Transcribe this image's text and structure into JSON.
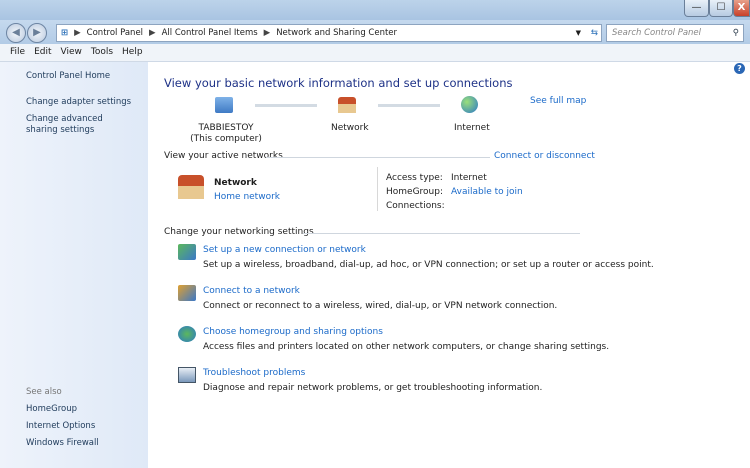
{
  "window": {
    "minimize": "—",
    "maximize": "☐",
    "close": "X"
  },
  "address": {
    "crumbs": [
      "Control Panel",
      "All Control Panel Items",
      "Network and Sharing Center"
    ],
    "search_placeholder": "Search Control Panel"
  },
  "menu": [
    "File",
    "Edit",
    "View",
    "Tools",
    "Help"
  ],
  "sidebar": {
    "home": "Control Panel Home",
    "items": [
      "Change adapter settings",
      "Change advanced sharing settings"
    ],
    "see_also_label": "See also",
    "see_also": [
      "HomeGroup",
      "Internet Options",
      "Windows Firewall"
    ]
  },
  "main": {
    "title": "View your basic network information and set up connections",
    "see_full_map": "See full map",
    "map": {
      "computer": "TABBIESTOY",
      "computer_sub": "(This computer)",
      "network": "Network",
      "internet": "Internet"
    },
    "active_label": "View your active networks",
    "connect_disconnect": "Connect or disconnect",
    "network_name": "Network",
    "network_type": "Home network",
    "access_type_label": "Access type:",
    "access_type": "Internet",
    "homegroup_label": "HomeGroup:",
    "homegroup": "Available to join",
    "connections_label": "Connections:",
    "change_label": "Change your networking settings",
    "tasks": [
      {
        "title": "Set up a new connection or network",
        "desc": "Set up a wireless, broadband, dial-up, ad hoc, or VPN connection; or set up a router or access point."
      },
      {
        "title": "Connect to a network",
        "desc": "Connect or reconnect to a wireless, wired, dial-up, or VPN network connection."
      },
      {
        "title": "Choose homegroup and sharing options",
        "desc": "Access files and printers located on other network computers, or change sharing settings."
      },
      {
        "title": "Troubleshoot problems",
        "desc": "Diagnose and repair network problems, or get troubleshooting information."
      }
    ]
  }
}
